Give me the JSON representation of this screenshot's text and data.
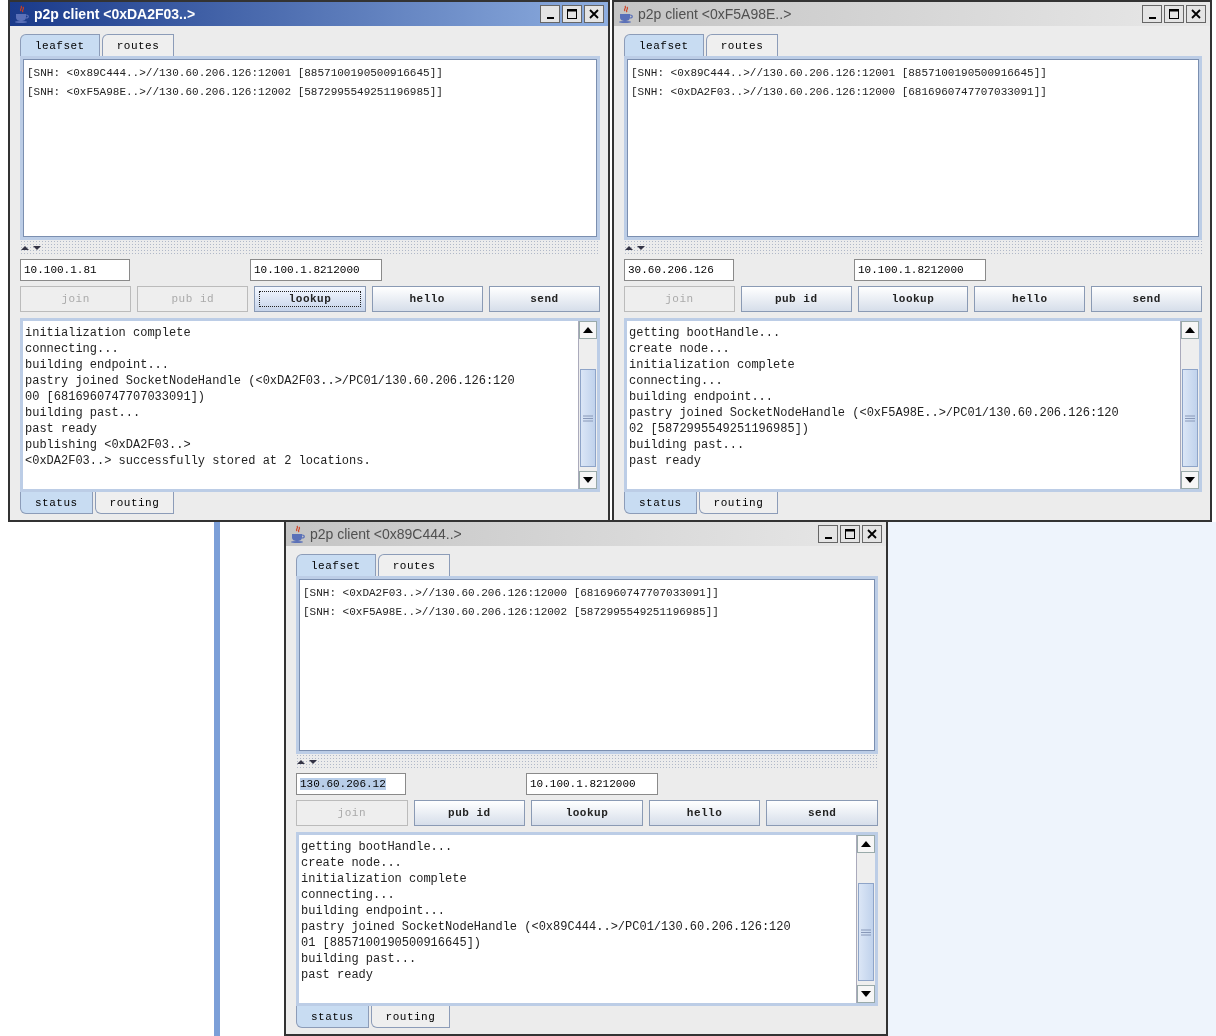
{
  "windows": [
    {
      "title": "p2p client <0xDA2F03..>",
      "active": true,
      "top_tabs": [
        {
          "label": "leafset",
          "selected": true
        },
        {
          "label": "routes",
          "selected": false
        }
      ],
      "leafset": [
        "[SNH: <0x89C444..>//130.60.206.126:12001 [8857100190500916645]]",
        "[SNH: <0xF5A98E..>//130.60.206.126:12002 [5872995549251196985]]"
      ],
      "fields": [
        {
          "value": "10.100.1.81",
          "text_selected": false
        },
        {
          "value": "10.100.1.8212000",
          "text_selected": false
        }
      ],
      "buttons": [
        {
          "label": "join",
          "disabled": true,
          "focused": false
        },
        {
          "label": "pub id",
          "disabled": true,
          "focused": false
        },
        {
          "label": "lookup",
          "disabled": false,
          "focused": true
        },
        {
          "label": "hello",
          "disabled": false,
          "focused": false
        },
        {
          "label": "send",
          "disabled": false,
          "focused": false
        }
      ],
      "log": [
        "initialization complete",
        "connecting...",
        "building endpoint...",
        "pastry joined SocketNodeHandle (<0xDA2F03..>/PC01/130.60.206.126:120",
        "00 [6816960747707033091])",
        "building past...",
        "past ready",
        "publishing <0xDA2F03..>",
        "<0xDA2F03..> successfully stored at 2 locations."
      ],
      "bottom_tabs": [
        {
          "label": "status",
          "selected": true
        },
        {
          "label": "routing",
          "selected": false
        }
      ]
    },
    {
      "title": "p2p client <0xF5A98E..>",
      "active": false,
      "top_tabs": [
        {
          "label": "leafset",
          "selected": true
        },
        {
          "label": "routes",
          "selected": false
        }
      ],
      "leafset": [
        "[SNH: <0x89C444..>//130.60.206.126:12001 [8857100190500916645]]",
        "[SNH: <0xDA2F03..>//130.60.206.126:12000 [6816960747707033091]]"
      ],
      "fields": [
        {
          "value": "30.60.206.126",
          "text_selected": false
        },
        {
          "value": "10.100.1.8212000",
          "text_selected": false
        }
      ],
      "buttons": [
        {
          "label": "join",
          "disabled": true,
          "focused": false
        },
        {
          "label": "pub id",
          "disabled": false,
          "focused": false
        },
        {
          "label": "lookup",
          "disabled": false,
          "focused": false
        },
        {
          "label": "hello",
          "disabled": false,
          "focused": false
        },
        {
          "label": "send",
          "disabled": false,
          "focused": false
        }
      ],
      "log": [
        "getting bootHandle...",
        "create node...",
        "initialization complete",
        "connecting...",
        "building endpoint...",
        "pastry joined SocketNodeHandle (<0xF5A98E..>/PC01/130.60.206.126:120",
        "02 [5872995549251196985])",
        "building past...",
        "past ready"
      ],
      "bottom_tabs": [
        {
          "label": "status",
          "selected": true
        },
        {
          "label": "routing",
          "selected": false
        }
      ]
    },
    {
      "title": "p2p client <0x89C444..>",
      "active": false,
      "top_tabs": [
        {
          "label": "leafset",
          "selected": true
        },
        {
          "label": "routes",
          "selected": false
        }
      ],
      "leafset": [
        "[SNH: <0xDA2F03..>//130.60.206.126:12000 [6816960747707033091]]",
        "[SNH: <0xF5A98E..>//130.60.206.126:12002 [5872995549251196985]]"
      ],
      "fields": [
        {
          "value": "130.60.206.12",
          "text_selected": true
        },
        {
          "value": "10.100.1.8212000",
          "text_selected": false
        }
      ],
      "buttons": [
        {
          "label": "join",
          "disabled": true,
          "focused": false
        },
        {
          "label": "pub id",
          "disabled": false,
          "focused": false
        },
        {
          "label": "lookup",
          "disabled": false,
          "focused": false
        },
        {
          "label": "hello",
          "disabled": false,
          "focused": false
        },
        {
          "label": "send",
          "disabled": false,
          "focused": false
        }
      ],
      "log": [
        "getting bootHandle...",
        "create node...",
        "initialization complete",
        "connecting...",
        "building endpoint...",
        "pastry joined SocketNodeHandle (<0x89C444..>/PC01/130.60.206.126:120",
        "01 [8857100190500916645])",
        "building past...",
        "past ready"
      ],
      "bottom_tabs": [
        {
          "label": "status",
          "selected": true
        },
        {
          "label": "routing",
          "selected": false
        }
      ]
    }
  ]
}
